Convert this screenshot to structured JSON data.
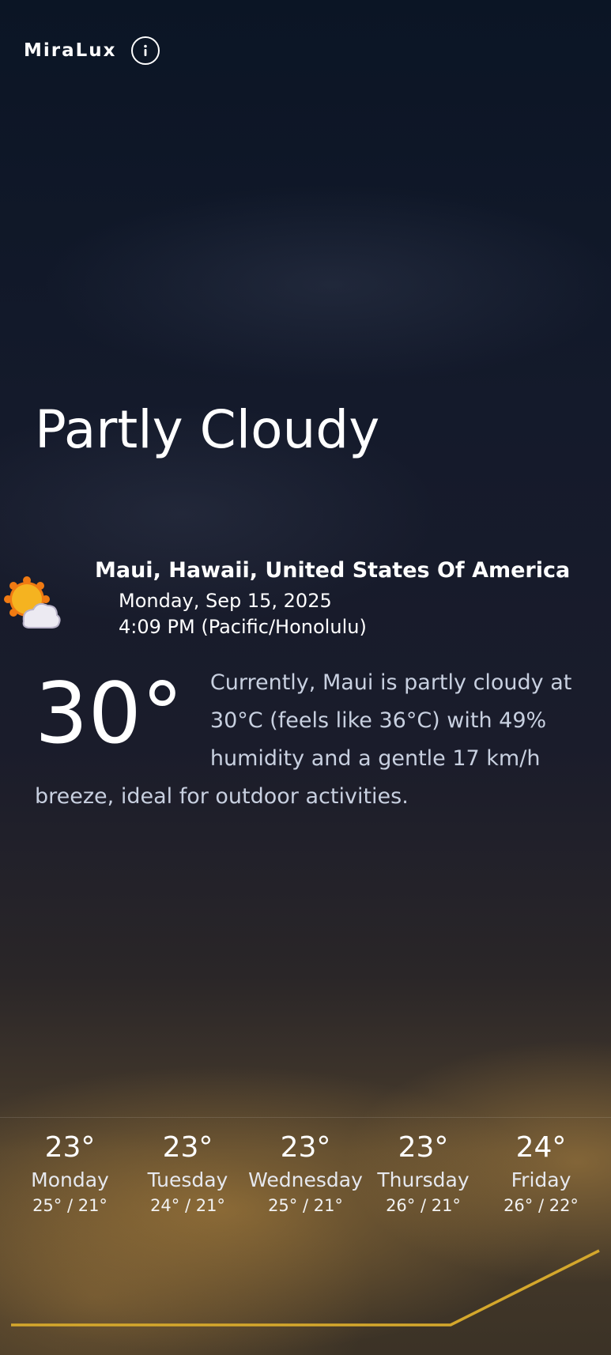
{
  "app": {
    "name": "MiraLux",
    "info_icon": "info-icon"
  },
  "condition": "Partly Cloudy",
  "location": {
    "name": "Maui, Hawaii, United States Of America",
    "date": "Monday, Sep 15, 2025",
    "time": "4:09 PM (Pacific/Honolulu)",
    "icon": "partly-cloudy-icon"
  },
  "current": {
    "temperature": "30°",
    "summary": "Currently, Maui is partly cloudy at 30°C (feels like 36°C) with 49% humidity and a gentle 17 km/h breeze, ideal for outdoor activities."
  },
  "forecast": [
    {
      "temp": "23°",
      "day": "Monday",
      "range": "25° / 21°"
    },
    {
      "temp": "23°",
      "day": "Tuesday",
      "range": "24° / 21°"
    },
    {
      "temp": "23°",
      "day": "Wednesday",
      "range": "25° / 21°"
    },
    {
      "temp": "23°",
      "day": "Thursday",
      "range": "26° / 21°"
    },
    {
      "temp": "24°",
      "day": "Friday",
      "range": "26° / 22°"
    }
  ],
  "colors": {
    "trend_line": "#d4a72c",
    "sun": "#f5a91e",
    "sun_outline": "#f07a12",
    "cloud": "#eceaf2"
  }
}
